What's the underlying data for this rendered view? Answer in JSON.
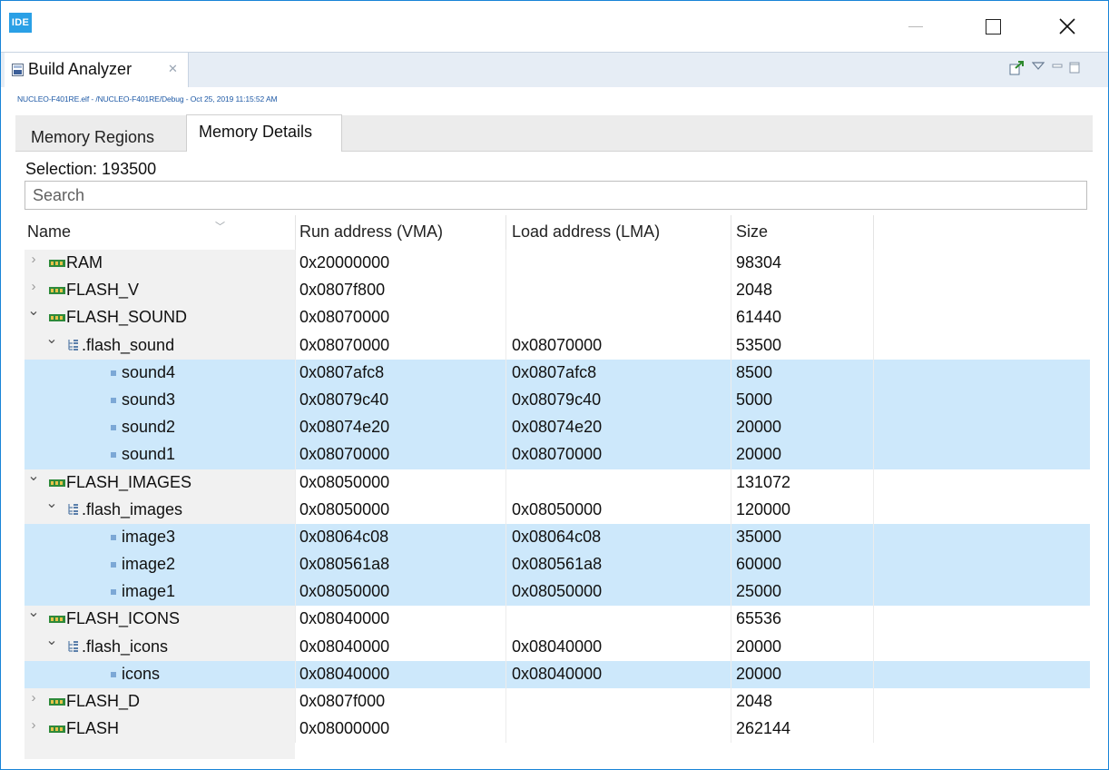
{
  "window": {
    "logo_text": "IDE",
    "controls": {
      "minimize": "—",
      "maximize": "□",
      "close": "✕"
    }
  },
  "view_tab": {
    "label": "Build Analyzer",
    "icon": "build-analyzer-icon",
    "close_icon": "close-icon"
  },
  "view_toolbar": [
    "export-icon",
    "view-menu-icon",
    "minimize-icon",
    "maximize-icon"
  ],
  "path_text": "NUCLEO-F401RE.elf - /NUCLEO-F401RE/Debug - Oct 25, 2019 11:15:52 AM",
  "inner_tabs": [
    {
      "label": "Memory Regions",
      "active": false
    },
    {
      "label": "Memory Details",
      "active": true
    }
  ],
  "selection_text": "Selection: 193500",
  "search": {
    "placeholder": "Search",
    "value": ""
  },
  "table": {
    "columns": [
      "Name",
      "Run address (VMA)",
      "Load address (LMA)",
      "Size"
    ],
    "rows": [
      {
        "level": 0,
        "kind": "region",
        "state": "collapsed",
        "name": "RAM",
        "vma": "0x20000000",
        "lma": "",
        "size": "98304",
        "selected": false
      },
      {
        "level": 0,
        "kind": "region",
        "state": "collapsed",
        "name": "FLASH_V",
        "vma": "0x0807f800",
        "lma": "",
        "size": "2048",
        "selected": false
      },
      {
        "level": 0,
        "kind": "region",
        "state": "expanded",
        "name": "FLASH_SOUND",
        "vma": "0x08070000",
        "lma": "",
        "size": "61440",
        "selected": false
      },
      {
        "level": 1,
        "kind": "section",
        "state": "expanded",
        "name": ".flash_sound",
        "vma": "0x08070000",
        "lma": "0x08070000",
        "size": "53500",
        "selected": false
      },
      {
        "level": 2,
        "kind": "symbol",
        "state": "leaf",
        "name": "sound4",
        "vma": "0x0807afc8",
        "lma": "0x0807afc8",
        "size": "8500",
        "selected": true
      },
      {
        "level": 2,
        "kind": "symbol",
        "state": "leaf",
        "name": "sound3",
        "vma": "0x08079c40",
        "lma": "0x08079c40",
        "size": "5000",
        "selected": true
      },
      {
        "level": 2,
        "kind": "symbol",
        "state": "leaf",
        "name": "sound2",
        "vma": "0x08074e20",
        "lma": "0x08074e20",
        "size": "20000",
        "selected": true
      },
      {
        "level": 2,
        "kind": "symbol",
        "state": "leaf",
        "name": "sound1",
        "vma": "0x08070000",
        "lma": "0x08070000",
        "size": "20000",
        "selected": true
      },
      {
        "level": 0,
        "kind": "region",
        "state": "expanded",
        "name": "FLASH_IMAGES",
        "vma": "0x08050000",
        "lma": "",
        "size": "131072",
        "selected": false
      },
      {
        "level": 1,
        "kind": "section",
        "state": "expanded",
        "name": ".flash_images",
        "vma": "0x08050000",
        "lma": "0x08050000",
        "size": "120000",
        "selected": false
      },
      {
        "level": 2,
        "kind": "symbol",
        "state": "leaf",
        "name": "image3",
        "vma": "0x08064c08",
        "lma": "0x08064c08",
        "size": "35000",
        "selected": true
      },
      {
        "level": 2,
        "kind": "symbol",
        "state": "leaf",
        "name": "image2",
        "vma": "0x080561a8",
        "lma": "0x080561a8",
        "size": "60000",
        "selected": true
      },
      {
        "level": 2,
        "kind": "symbol",
        "state": "leaf",
        "name": "image1",
        "vma": "0x08050000",
        "lma": "0x08050000",
        "size": "25000",
        "selected": true
      },
      {
        "level": 0,
        "kind": "region",
        "state": "expanded",
        "name": "FLASH_ICONS",
        "vma": "0x08040000",
        "lma": "",
        "size": "65536",
        "selected": false
      },
      {
        "level": 1,
        "kind": "section",
        "state": "expanded",
        "name": ".flash_icons",
        "vma": "0x08040000",
        "lma": "0x08040000",
        "size": "20000",
        "selected": false
      },
      {
        "level": 2,
        "kind": "symbol",
        "state": "leaf",
        "name": "icons",
        "vma": "0x08040000",
        "lma": "0x08040000",
        "size": "20000",
        "selected": true
      },
      {
        "level": 0,
        "kind": "region",
        "state": "collapsed",
        "name": "FLASH_D",
        "vma": "0x0807f000",
        "lma": "",
        "size": "2048",
        "selected": false
      },
      {
        "level": 0,
        "kind": "region",
        "state": "collapsed",
        "name": "FLASH",
        "vma": "0x08000000",
        "lma": "",
        "size": "262144",
        "selected": false
      }
    ]
  },
  "colors": {
    "selection_bg": "#cde8fb",
    "window_border": "#1883d7",
    "logo_bg": "#2aa0e6",
    "viewbar_bg": "#e6edf5",
    "path_text": "#1f5aa6"
  }
}
